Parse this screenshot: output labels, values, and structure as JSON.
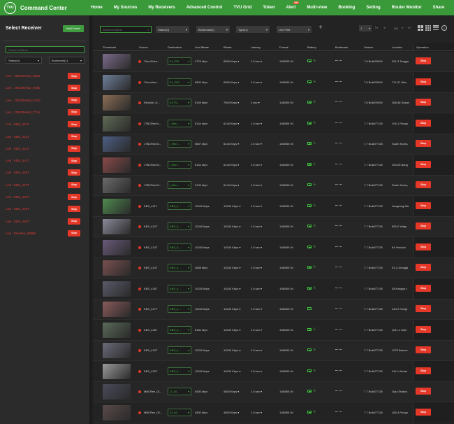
{
  "app": {
    "logo_text": "TVU",
    "title": "Command Center"
  },
  "nav": [
    {
      "label": "Home",
      "active": true
    },
    {
      "label": "My Sources"
    },
    {
      "label": "My Receivers"
    },
    {
      "label": "Advanced Control"
    },
    {
      "label": "TVU Grid"
    },
    {
      "label": "Token"
    },
    {
      "label": "Alert",
      "badge": "99+"
    },
    {
      "label": "Multi-view"
    },
    {
      "label": "Booking"
    },
    {
      "label": "Setting"
    },
    {
      "label": "Router Monitor"
    },
    {
      "label": "Share"
    }
  ],
  "sidebar": {
    "title": "Select Receiver",
    "multi_control_label": "Multi-Control",
    "search_placeholder": "Search a Name",
    "status_select": "Status(4)",
    "bookmark_select": "Bookmark(1)",
    "stop_label": "Stop",
    "receivers": [
      "Live : JTBCRen01_9833",
      "Live : JTBCRen02_9035",
      "Live : JTBCRen03_57C6",
      "Live : JTBCRen04_7714",
      "Live : KBS_411T",
      "Live : KBS_412T",
      "Live : KBS_413T",
      "Live : KBS_414T",
      "Live : KBS_416T",
      "Live : KBS_417T",
      "Live : KBS_418T",
      "Live : KBS_419T",
      "Live : KBS_420T",
      "Live : Election_09686"
    ]
  },
  "toolbar": {
    "search_placeholder": "Search a Name",
    "status_select": "Status(4)",
    "bookmark_select": "Bookmark(1)",
    "type_select": "Type(1)",
    "sort_select": "Live First",
    "page_size": "1",
    "page_text": "1/4"
  },
  "table": {
    "columns": [
      "Thumbnail",
      "Source",
      "Destination",
      "Live Bitrate",
      "Bitrate",
      "Latency",
      "Format",
      "Battery",
      "Bookmark",
      "Version",
      "Location",
      "Operation"
    ],
    "stop_label": "Stop",
    "rows": [
      {
        "source": "ChunCheo...",
        "dest": "01_F51",
        "live_bitrate": "4776 kbps",
        "bitrate": "6500 Kbps",
        "latency": "1.5 sec",
        "format": "1080i59.94",
        "version": "7.6 Build76094",
        "location": "201-3 Toegye",
        "thumb": "#7b6a8a"
      },
      {
        "source": "Chuncheo...",
        "dest": "01_F52",
        "live_bitrate": "6500 kbps",
        "bitrate": "6500 Kbps",
        "latency": "1.5 sec",
        "format": "1080i59.94",
        "version": "7.6 Build76094",
        "location": "711-57 Uiko",
        "thumb": "#6e7f9a"
      },
      {
        "source": "Election_D...",
        "dest": "KCTV...",
        "live_bitrate": "5149 kbps",
        "bitrate": "7000 Kbps",
        "latency": "2 sec",
        "format": "1080i59.94",
        "version": "7.6 Build76094",
        "location": "268-48 Susan",
        "thumb": "#8a6d55"
      },
      {
        "source": "JTBCRen01...",
        "dest": "l_Ren...",
        "live_bitrate": "6144 kbps",
        "bitrate": "6144 Kbps",
        "latency": "1.5 sec",
        "format": "1080i59.94",
        "version": "7.7 Build77135",
        "location": "194-1 Pungn",
        "thumb": "#5f6a55"
      },
      {
        "source": "JTBCRen02...",
        "dest": "l_Ren...",
        "live_bitrate": "5657 kbps",
        "bitrate": "6144 Kbps",
        "latency": "1.5 sec",
        "format": "1080i59.94",
        "version": "7.7 Build77135",
        "location": "South Korea,",
        "thumb": "#4d5f85"
      },
      {
        "source": "JTBCRen03...",
        "dest": "l_Ren...",
        "live_bitrate": "6144 kbps",
        "bitrate": "6144 Kbps",
        "latency": "1.5 sec",
        "format": "1080i59.94",
        "version": "7.7 Build77135",
        "location": "493-28 Bang",
        "thumb": "#8a4a4a"
      },
      {
        "source": "JTBCRen04...",
        "dest": "l_Ren...",
        "live_bitrate": "2109 kbps",
        "bitrate": "6144 Kbps",
        "latency": "1.5 sec",
        "format": "1080i59.94",
        "version": "7.7 Build77135",
        "location": "South Korea,",
        "thumb": "#6b6b6b"
      },
      {
        "source": "KBS_411T",
        "dest": "KBS_4...",
        "live_bitrate": "10240 kbps",
        "bitrate": "10240 Kbps",
        "latency": "1.5 sec",
        "format": "1080i59.94",
        "version": "7.7 Build77135",
        "location": "Jangsung Ma",
        "thumb": "#4f8a4f"
      },
      {
        "source": "KBS_412T",
        "dest": "KBS_4...",
        "live_bitrate": "10240 kbps",
        "bitrate": "10240 Kbps",
        "latency": "1.5 sec",
        "format": "1080i59.94",
        "version": "7.7 Build77135",
        "location": "553-2 Yatap",
        "thumb": "#8a8a9a"
      },
      {
        "source": "KBS_413T",
        "dest": "KBS_4...",
        "live_bitrate": "10240 kbps",
        "bitrate": "10240 Kbps",
        "latency": "1.5 sec",
        "format": "1080i59.94",
        "version": "7.7 Build77135",
        "location": "84 Yeouido",
        "thumb": "#6a5a7a"
      },
      {
        "source": "KBS_414T",
        "dest": "KBS_4...",
        "live_bitrate": "2668 kbps",
        "bitrate": "10240 Kbps",
        "latency": "1.5 sec",
        "format": "1080i59.94",
        "version": "7.7 Build77135",
        "location": "91-3 Jeongja",
        "thumb": "#7a5050"
      },
      {
        "source": "KBS_416T",
        "dest": "KBS_4...",
        "live_bitrate": "10230 kbps",
        "bitrate": "10240 Kbps",
        "latency": "1.5 sec",
        "format": "1080i59.94",
        "version": "7.7 Build77135",
        "location": "38 Nangye-r",
        "thumb": "#5a5a6a"
      },
      {
        "source": "KBS_417T",
        "dest": "KBS_4...",
        "live_bitrate": "10240 kbps",
        "bitrate": "10240 Kbps",
        "latency": "1.5 sec",
        "format": "1080i59.94",
        "version": "7.7 Build77135",
        "location": "440-2 Gongl",
        "thumb": "#8a5a5a",
        "battery_empty": true
      },
      {
        "source": "KBS_418T",
        "dest": "KBS_4...",
        "live_bitrate": "6384 kbps",
        "bitrate": "10240 Kbps",
        "latency": "1.5 sec",
        "format": "1080i59.94",
        "version": "7.7 Build77135",
        "location": "(S41-1 Wan",
        "thumb": "#5a6a5a"
      },
      {
        "source": "KBS_419T",
        "dest": "KBS_4...",
        "live_bitrate": "10240 kbps",
        "bitrate": "10240 Kbps",
        "latency": "1.5 sec",
        "format": "1080i59.94",
        "version": "7.7 Build77135",
        "location": "1075 Baeme",
        "thumb": "#6a6a7a"
      },
      {
        "source": "KBS_420T",
        "dest": "KBS_4...",
        "live_bitrate": "10240 kbps",
        "bitrate": "10240 Kbps",
        "latency": "1.8 sec",
        "format": "1080i59.94",
        "version": "7.7 Build77135",
        "location": "411-1 Achao",
        "thumb": "#9a9a9a"
      },
      {
        "source": "MBCRen_01...",
        "dest": "11_M...",
        "live_bitrate": "4500 kbps",
        "bitrate": "4500 Kbps",
        "latency": "1.5 sec",
        "format": "1080i59.94",
        "version": "7.7 Build77135",
        "location": "Gaul Station",
        "thumb": "#4a4a5a"
      },
      {
        "source": "MBCRen_02...",
        "dest": "12_M...",
        "live_bitrate": "4500 kbps",
        "bitrate": "4500 Kbps",
        "latency": "1.5 sec",
        "format": "1080i59.94",
        "version": "7.7 Build77135",
        "location": "185-3 Pungn",
        "thumb": "#5a4a4a"
      }
    ]
  },
  "colors": {
    "brand_green": "#3a9a3a",
    "stop_red": "#e53828",
    "live_red": "#e03b35"
  }
}
